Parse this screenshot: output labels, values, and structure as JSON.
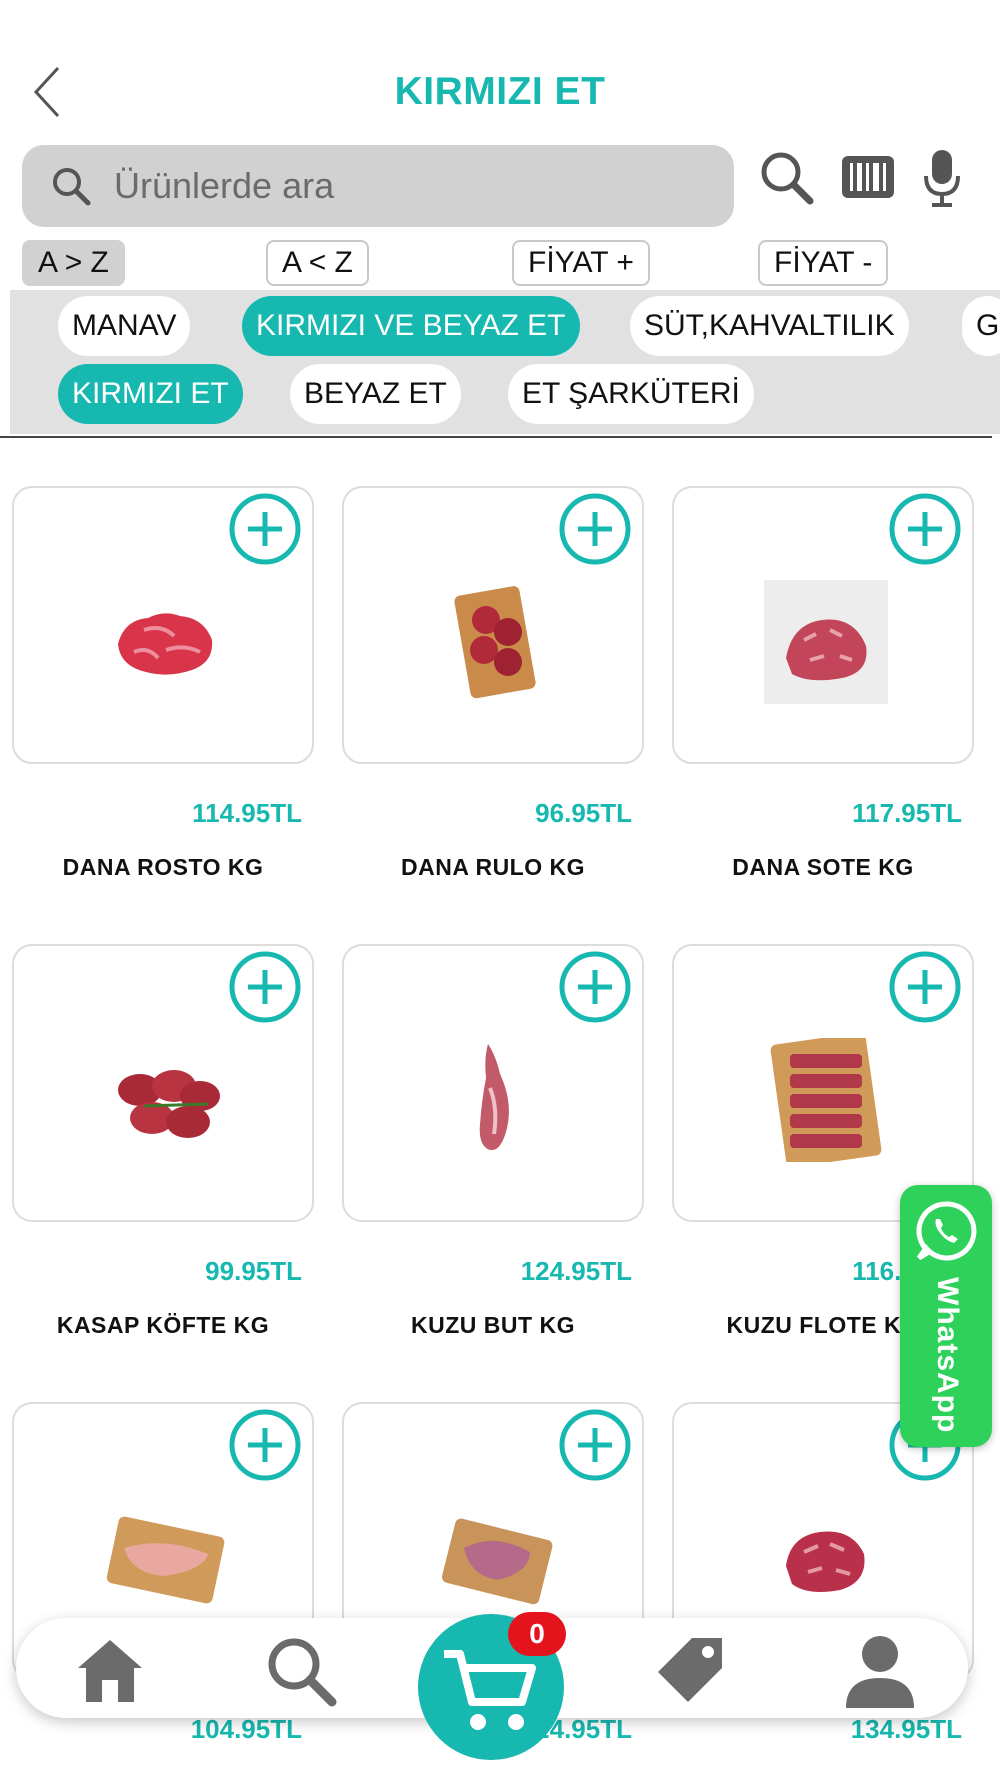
{
  "header": {
    "title": "KIRMIZI ET"
  },
  "search": {
    "placeholder": "Ürünlerde ara"
  },
  "icons": {
    "back": "chevron-left-icon",
    "search": "search-icon",
    "barcode": "barcode-icon",
    "mic": "microphone-icon",
    "add": "plus-circle-icon",
    "whatsapp": "whatsapp-icon",
    "home": "home-icon",
    "cart": "cart-icon",
    "tag": "tag-icon",
    "user": "user-icon"
  },
  "sort": {
    "az": "A > Z",
    "za": "A < Z",
    "price_up": "FİYAT +",
    "price_down": "FİYAT -"
  },
  "categories": [
    "MANAV",
    "KIRMIZI VE BEYAZ ET",
    "SÜT,KAHVALTILIK",
    "G"
  ],
  "subcategories": [
    "KIRMIZI ET",
    "BEYAZ ET",
    "ET ŞARKÜTERİ"
  ],
  "products": [
    {
      "name": "DANA ROSTO KG",
      "price": "114.95TL"
    },
    {
      "name": "DANA RULO KG",
      "price": "96.95TL"
    },
    {
      "name": "DANA SOTE KG",
      "price": "117.95TL"
    },
    {
      "name": "KASAP KÖFTE KG",
      "price": "99.95TL"
    },
    {
      "name": "KUZU BUT KG",
      "price": "124.95TL"
    },
    {
      "name": "KUZU FLOTE KG",
      "price": "116.95TL"
    },
    {
      "name": "",
      "price": "104.95TL"
    },
    {
      "name": "",
      "price": "124.95TL"
    },
    {
      "name": "",
      "price": "134.95TL"
    }
  ],
  "whatsapp": {
    "label": "WhatsApp"
  },
  "cart": {
    "count": "0"
  },
  "colors": {
    "accent": "#16b8b0",
    "badge": "#e5141c",
    "whatsapp": "#2ed25a"
  }
}
